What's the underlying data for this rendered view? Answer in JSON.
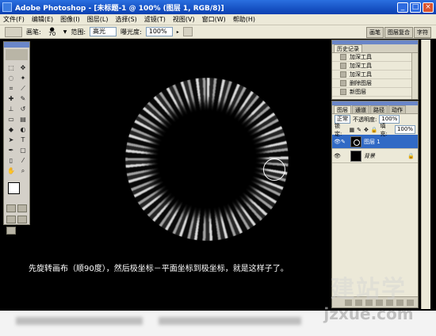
{
  "window": {
    "title": "Adobe Photoshop - [未标题-1 @ 100% (图层 1, RGB/8)]"
  },
  "menu": [
    "文件(F)",
    "编辑(E)",
    "图像(I)",
    "图层(L)",
    "选择(S)",
    "滤镜(T)",
    "视图(V)",
    "窗口(W)",
    "帮助(H)"
  ],
  "options": {
    "brush_label": "画笔:",
    "brush_size": "70",
    "range_label": "范围:",
    "range_value": "高光",
    "exposure_label": "曝光度:",
    "exposure_value": "100%"
  },
  "dock_tabs": [
    "画笔",
    "图层复合",
    "字符"
  ],
  "history": {
    "tab": "历史记录",
    "items": [
      "加深工具",
      "加深工具",
      "加深工具",
      "删除图层",
      "新图层"
    ]
  },
  "layers": {
    "tabs": [
      "图层",
      "通道",
      "路径",
      "动作"
    ],
    "blend_mode": "正常",
    "opacity_label": "不透明度:",
    "opacity_value": "100%",
    "lock_label": "锁定:",
    "fill_label": "填充:",
    "fill_value": "100%",
    "items": [
      {
        "name": "图层 1",
        "selected": true
      },
      {
        "name": "背景",
        "selected": false
      }
    ]
  },
  "caption": "先旋转画布（顺90度），然后极坐标－平面坐标到极坐标，就是这样子了。",
  "watermark": {
    "cn": "建站学",
    "en": "jzxue.com"
  }
}
